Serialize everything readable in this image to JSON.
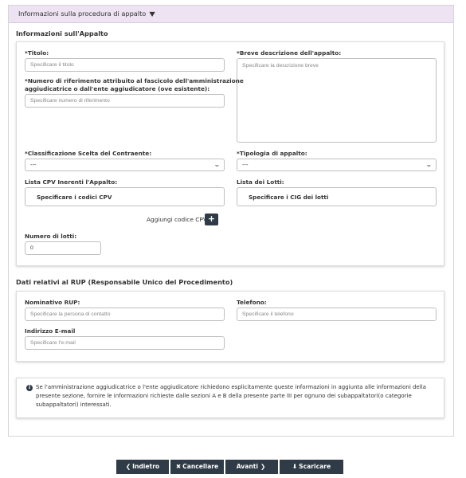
{
  "accordion": {
    "title": "Informazioni sulla procedura di appalto"
  },
  "appalto": {
    "section_title": "Informazioni sull'Appalto",
    "titolo": {
      "label": "*Titolo:",
      "placeholder": "Specificare il titolo"
    },
    "breve_descrizione": {
      "label": "*Breve descrizione dell'appalto:",
      "placeholder": "Specificare la descrizione breve"
    },
    "numero_riferimento": {
      "label_line1": "*Numero di riferimento attribuito al fascicolo dell'amministrazione",
      "label_line2": "aggiudicatrice o dall'ente aggiudicatore (ove esistente):",
      "placeholder": "Specificare numero di riferimento"
    },
    "classificazione": {
      "label": "*Classificazione Scelta del Contraente:",
      "value": "---"
    },
    "tipologia": {
      "label": "*Tipologia di appalto:",
      "value": "---"
    },
    "lista_cpv": {
      "label": "Lista CPV Inerenti l'Appalto:",
      "box_text": "Specificare i codici CPV"
    },
    "lista_lotti": {
      "label": "Lista dei Lotti:",
      "box_text": "Specificare i CIG dei lotti"
    },
    "aggiungi_cpv": {
      "label": "Aggiungi codice CPV",
      "button": "+"
    },
    "numero_lotti": {
      "label": "Numero di lotti:",
      "value": "0"
    }
  },
  "rup": {
    "section_title": "Dati relativi al RUP (Responsabile Unico del Procedimento)",
    "nominativo": {
      "label": "Nominativo RUP:",
      "placeholder": "Specificare la persona di contatto"
    },
    "telefono": {
      "label": "Telefono:",
      "placeholder": "Specificare il telefono"
    },
    "email": {
      "label": "Indirizzo E-mail",
      "placeholder": "Specificare l'e-mail"
    }
  },
  "info": {
    "icon": "info-icon",
    "line1": "Se l'amministrazione aggiudicatrice o l'ente aggiudicatore richiedono esplicitamente queste informazioni in aggiunta alle informazioni della",
    "line2": "presente sezione, fornire le informazioni richieste dalle sezioni A e B della presente parte III per ognuno dei subappaltatori(o categorie",
    "line3": "subappaltatori) interessati."
  },
  "footer": {
    "indietro": "Indietro",
    "cancellare": "Cancellare",
    "avanti": "Avanti",
    "scaricare": "Scaricare"
  },
  "colors": {
    "accordion_bg": "#ede3f2",
    "button_bg": "#2f3b46"
  }
}
